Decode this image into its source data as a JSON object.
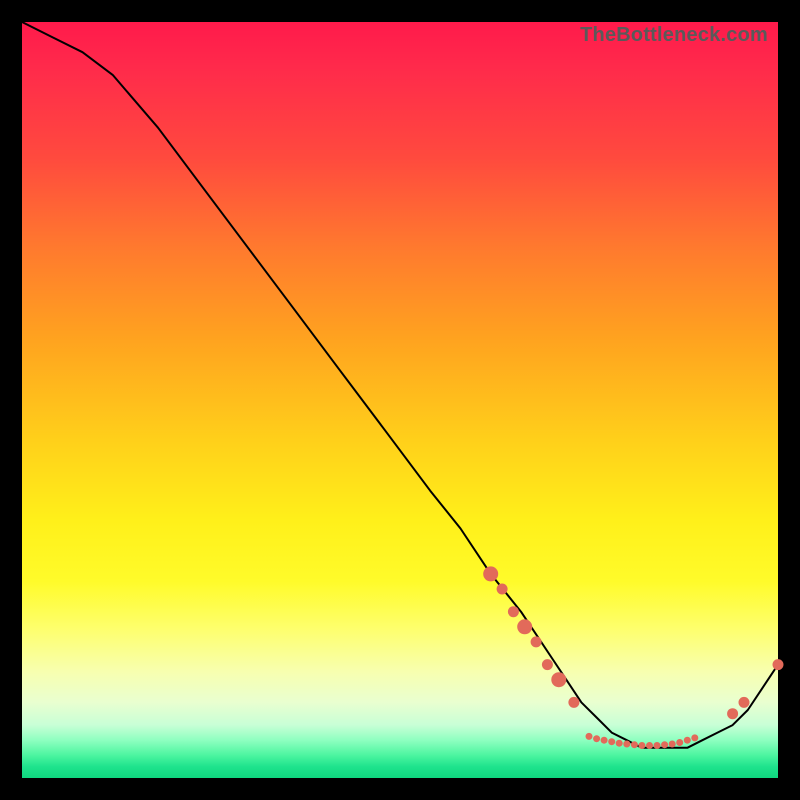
{
  "watermark": "TheBottleneck.com",
  "colors": {
    "marker": "#e26a5a",
    "line": "#000000",
    "gradient_top": "#ff1a4b",
    "gradient_bottom": "#0fd77f"
  },
  "chart_data": {
    "type": "line",
    "title": "",
    "xlabel": "",
    "ylabel": "",
    "xlim": [
      0,
      100
    ],
    "ylim": [
      0,
      100
    ],
    "grid": false,
    "legend": false,
    "note": "Axes are unlabeled; x/y in percent of plot area, y=0 at bottom.",
    "series": [
      {
        "name": "curve",
        "x": [
          0,
          4,
          8,
          12,
          18,
          24,
          30,
          36,
          42,
          48,
          54,
          58,
          62,
          66,
          70,
          72,
          74,
          76,
          78,
          80,
          82,
          84,
          86,
          88,
          90,
          92,
          94,
          96,
          98,
          100
        ],
        "y": [
          100,
          98,
          96,
          93,
          86,
          78,
          70,
          62,
          54,
          46,
          38,
          33,
          27,
          22,
          16,
          13,
          10,
          8,
          6,
          5,
          4,
          4,
          4,
          4,
          5,
          6,
          7,
          9,
          12,
          15
        ]
      }
    ],
    "markers": [
      {
        "x": 62,
        "y": 27,
        "size": "lg"
      },
      {
        "x": 63.5,
        "y": 25,
        "size": "md"
      },
      {
        "x": 65,
        "y": 22,
        "size": "md"
      },
      {
        "x": 66.5,
        "y": 20,
        "size": "lg"
      },
      {
        "x": 68,
        "y": 18,
        "size": "md"
      },
      {
        "x": 69.5,
        "y": 15,
        "size": "md"
      },
      {
        "x": 71,
        "y": 13,
        "size": "lg"
      },
      {
        "x": 73,
        "y": 10,
        "size": "md"
      },
      {
        "x": 75,
        "y": 5.5,
        "size": "sm"
      },
      {
        "x": 76,
        "y": 5.2,
        "size": "sm"
      },
      {
        "x": 77,
        "y": 5.0,
        "size": "sm"
      },
      {
        "x": 78,
        "y": 4.8,
        "size": "sm"
      },
      {
        "x": 79,
        "y": 4.6,
        "size": "sm"
      },
      {
        "x": 80,
        "y": 4.5,
        "size": "sm"
      },
      {
        "x": 81,
        "y": 4.4,
        "size": "sm"
      },
      {
        "x": 82,
        "y": 4.3,
        "size": "sm"
      },
      {
        "x": 83,
        "y": 4.3,
        "size": "sm"
      },
      {
        "x": 84,
        "y": 4.3,
        "size": "sm"
      },
      {
        "x": 85,
        "y": 4.4,
        "size": "sm"
      },
      {
        "x": 86,
        "y": 4.5,
        "size": "sm"
      },
      {
        "x": 87,
        "y": 4.7,
        "size": "sm"
      },
      {
        "x": 88,
        "y": 5.0,
        "size": "sm"
      },
      {
        "x": 89,
        "y": 5.3,
        "size": "sm"
      },
      {
        "x": 94,
        "y": 8.5,
        "size": "md"
      },
      {
        "x": 95.5,
        "y": 10,
        "size": "md"
      },
      {
        "x": 100,
        "y": 15,
        "size": "md"
      }
    ]
  }
}
